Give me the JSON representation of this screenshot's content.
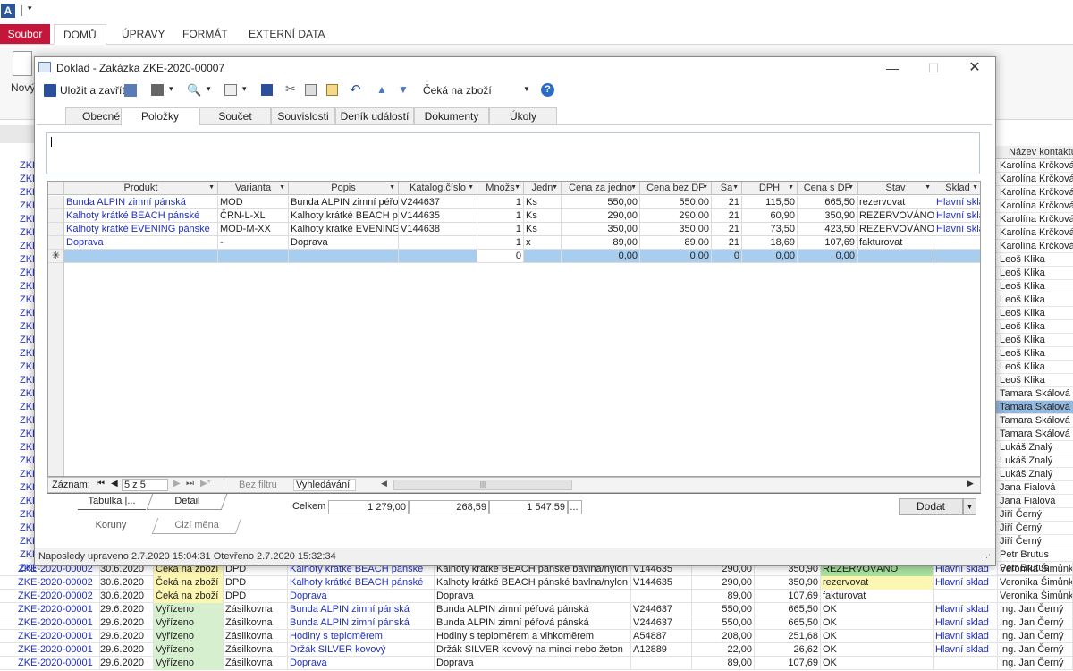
{
  "app": {
    "ribbon_tabs": [
      "DOMŮ",
      "ÚPRAVY",
      "FORMÁT",
      "EXTERNÍ DATA"
    ],
    "file_tab": "Soubor",
    "new_label": "Nový",
    "right_header": "Název kontaktu"
  },
  "dialog": {
    "title": "Doklad - Zakázka ZKE-2020-00007",
    "save_close": "Uložit a zavřít",
    "status_value": "Čeká na zboží",
    "tabs": [
      "Obecné",
      "Položky",
      "Součet",
      "Souvislosti",
      "Deník událostí",
      "Dokumenty",
      "Úkoly"
    ],
    "grid": {
      "headers": [
        "Produkt",
        "Varianta",
        "Popis",
        "Katalog.číslo",
        "Množs",
        "Jedn",
        "Cena za jedno",
        "Cena bez DF",
        "Sa",
        "DPH",
        "Cena s DF",
        "Stav",
        "Sklad"
      ],
      "rows": [
        [
          "Bunda ALPIN zimní pánská",
          "MOD",
          "Bunda ALPIN zimní péřov",
          "V244637",
          "1",
          "Ks",
          "550,00",
          "550,00",
          "21",
          "115,50",
          "665,50",
          "rezervovat",
          "Hlavní skla"
        ],
        [
          "Kalhoty krátké BEACH pánské",
          "ČRN-L-XL",
          "Kalhoty krátké BEACH pá",
          "V144635",
          "1",
          "Ks",
          "290,00",
          "290,00",
          "21",
          "60,90",
          "350,90",
          "REZERVOVÁNO",
          "Hlavní skla"
        ],
        [
          "Kalhoty krátké EVENING pánské",
          "MOD-M-XX",
          "Kalhoty krátké EVENING",
          "V144638",
          "1",
          "Ks",
          "350,00",
          "350,00",
          "21",
          "73,50",
          "423,50",
          "REZERVOVÁNO",
          "Hlavní skla"
        ],
        [
          "Doprava",
          "-",
          "Doprava",
          "",
          "1",
          "x",
          "89,00",
          "89,00",
          "21",
          "18,69",
          "107,69",
          "fakturovat",
          ""
        ]
      ],
      "new_row": [
        "",
        "",
        "",
        "",
        "0",
        "",
        "0,00",
        "0,00",
        "0",
        "0,00",
        "0,00",
        "",
        ""
      ]
    },
    "nav": {
      "label": "Záznam:",
      "position": "5 z 5",
      "no_filter": "Bez filtru",
      "search": "Vyhledávání"
    },
    "view_tabs": [
      "Tabulka",
      "Detail"
    ],
    "currency_tabs": [
      "Koruny",
      "Cizí měna"
    ],
    "total_label": "Celkem",
    "totals": [
      "1 279,00",
      "268,59",
      "1 547,59"
    ],
    "add_button": "Dodat",
    "status_bar": "Naposledy upraveno 2.7.2020 15:04:31 Otevřeno 2.7.2020 15:32:34"
  },
  "right_list": [
    "Karolína Krčková",
    "Karolína Krčková",
    "Karolína Krčková",
    "Karolína Krčková",
    "Karolína Krčková",
    "Karolína Krčková",
    "Karolína Krčková",
    "Leoš Klika",
    "Leoš Klika",
    "Leoš Klika",
    "Leoš Klika",
    "Leoš Klika",
    "Leoš Klika",
    "Leoš Klika",
    "Leoš Klika",
    "Leoš Klika",
    "Leoš Klika",
    "Tamara Skálová",
    "Tamara Skálová",
    "Tamara Skálová",
    "Tamara Skálová",
    "Lukáš Znalý",
    "Lukáš Znalý",
    "Lukáš Znalý",
    "Jana Fialová",
    "Jana Fialová",
    "Jiří Černý",
    "Jiří Černý",
    "Jiří Černý",
    "Petr Brutus",
    "Petr Brutus"
  ],
  "left_code": "ZKE",
  "bottom_rows": [
    [
      "ZKE-2020-00002",
      "30.6.2020",
      "Čeká na zboží",
      "DPD",
      "Kalhoty krátké BEACH pánské",
      "Kalhoty krátké BEACH pánské bavlna/nylon",
      "V144635",
      "290,00",
      "350,90",
      "REZERVOVÁNO",
      "Hlavní sklad",
      "Veronika Šimůnko"
    ],
    [
      "ZKE-2020-00002",
      "30.6.2020",
      "Čeká na zboží",
      "DPD",
      "Kalhoty krátké BEACH pánské",
      "Kalhoty krátké BEACH pánské bavlna/nylon",
      "V144635",
      "290,00",
      "350,90",
      "rezervovat",
      "Hlavní sklad",
      "Veronika Šimůnko"
    ],
    [
      "ZKE-2020-00002",
      "30.6.2020",
      "Čeká na zboží",
      "DPD",
      "Doprava",
      "Doprava",
      "",
      "89,00",
      "107,69",
      "fakturovat",
      "",
      "Veronika Šimůnko"
    ],
    [
      "ZKE-2020-00001",
      "29.6.2020",
      "Vyřízeno",
      "Zásilkovna",
      "Bunda ALPIN zimní pánská",
      "Bunda ALPIN zimní péřová  pánská",
      "V244637",
      "550,00",
      "665,50",
      "OK",
      "Hlavní sklad",
      "Ing. Jan Černý"
    ],
    [
      "ZKE-2020-00001",
      "29.6.2020",
      "Vyřízeno",
      "Zásilkovna",
      "Bunda ALPIN zimní pánská",
      "Bunda ALPIN zimní péřová  pánská",
      "V244637",
      "550,00",
      "665,50",
      "OK",
      "Hlavní sklad",
      "Ing. Jan Černý"
    ],
    [
      "ZKE-2020-00001",
      "29.6.2020",
      "Vyřízeno",
      "Zásilkovna",
      "Hodiny s teploměrem",
      "Hodiny s teploměrem a vlhkoměrem",
      "A54887",
      "208,00",
      "251,68",
      "OK",
      "Hlavní sklad",
      "Ing. Jan Černý"
    ],
    [
      "ZKE-2020-00001",
      "29.6.2020",
      "Vyřízeno",
      "Zásilkovna",
      "Držák SILVER kovový",
      "Držák SILVER kovový na minci nebo žeton",
      "A12889",
      "22,00",
      "26,62",
      "OK",
      "Hlavní sklad",
      "Ing. Jan Černý"
    ],
    [
      "ZKE-2020-00001",
      "29.6.2020",
      "Vyřízeno",
      "Zásilkovna",
      "Doprava",
      "Doprava",
      "",
      "89,00",
      "107,69",
      "OK",
      "",
      "Ing. Jan Černý"
    ]
  ]
}
